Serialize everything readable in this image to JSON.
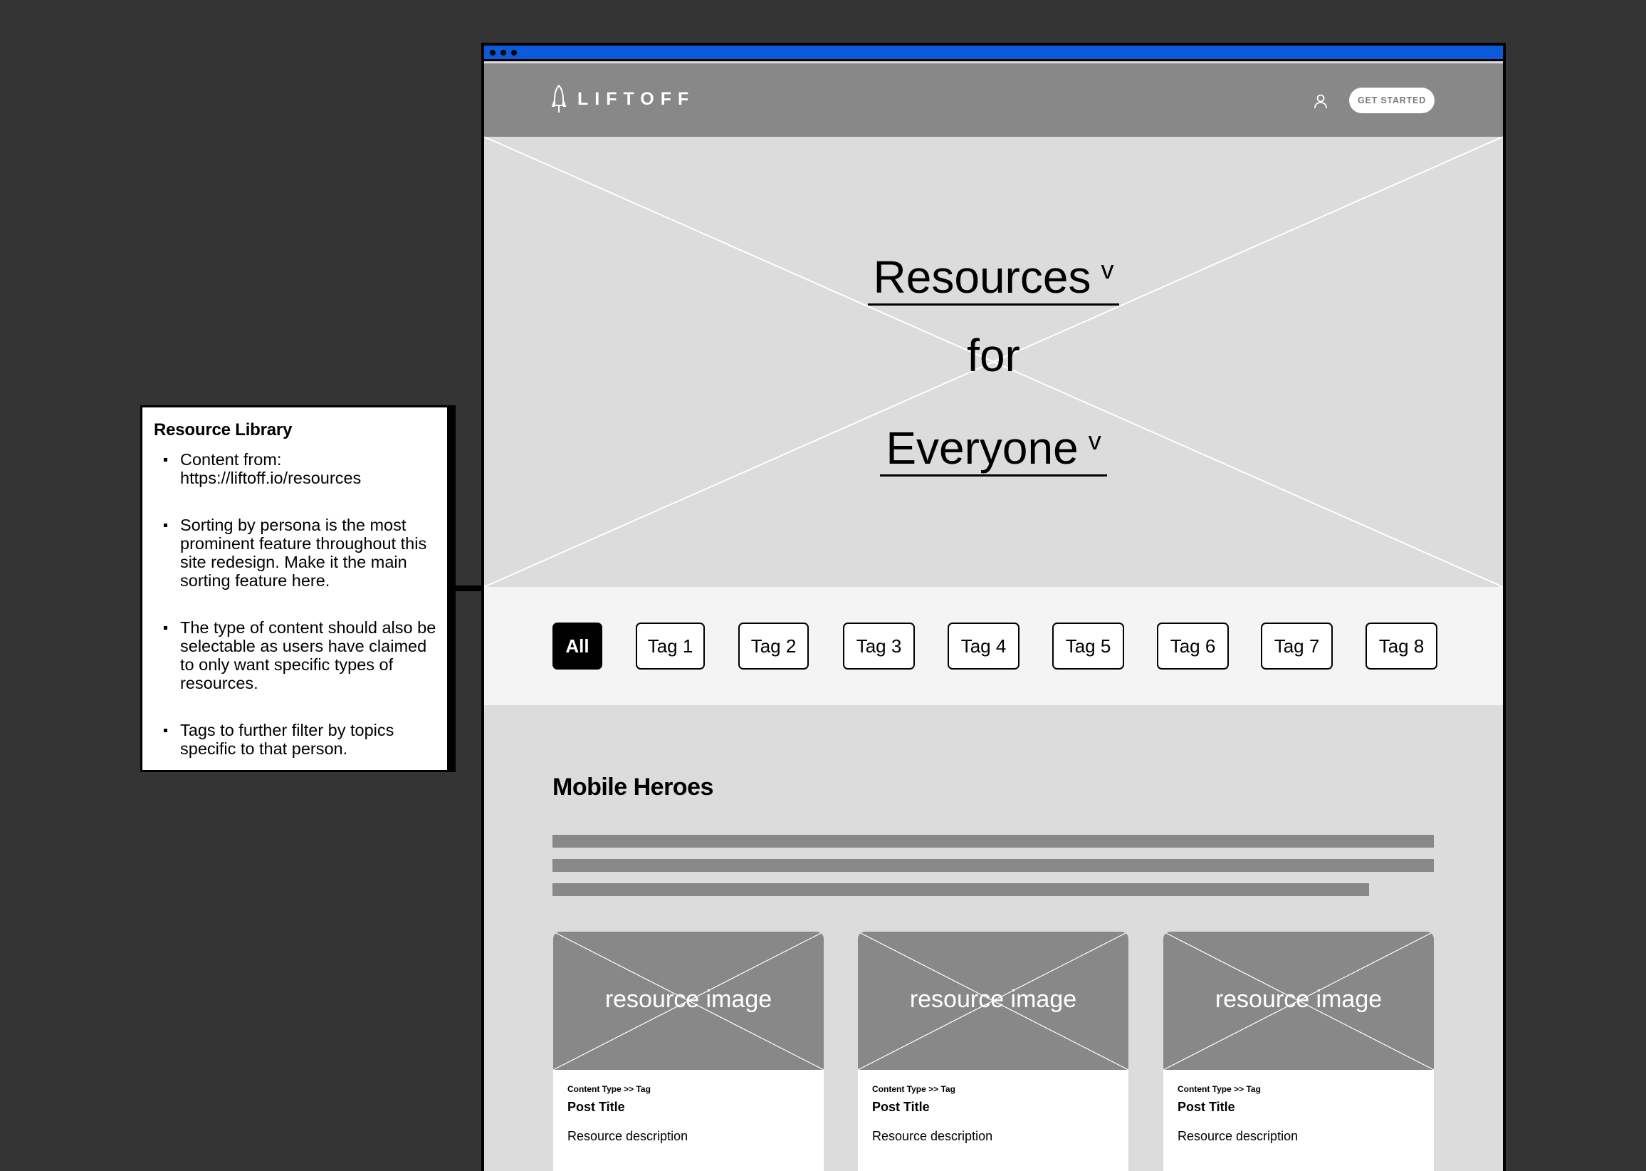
{
  "annotation": {
    "title": "Resource Library",
    "notes": [
      "Content from: https://liftoff.io/resources",
      "Sorting by persona is the most prominent feature throughout this site redesign. Make it the main sorting feature here.",
      "The type of content should also be selectable as users have claimed to only want specific types of resources.",
      "Tags to further filter by topics specific to that person."
    ]
  },
  "header": {
    "logo_text": "LIFTOFF",
    "cta_label": "GET STARTED"
  },
  "hero": {
    "line1": "Resources",
    "line2": "for",
    "line3": "Everyone",
    "caret": "v"
  },
  "tags": [
    "All",
    "Tag 1",
    "Tag 2",
    "Tag 3",
    "Tag 4",
    "Tag 5",
    "Tag 6",
    "Tag 7",
    "Tag 8"
  ],
  "active_tag": "All",
  "section": {
    "title": "Mobile Heroes"
  },
  "cards": [
    {
      "image_label": "resource image",
      "meta": "Content Type  >> Tag",
      "title": "Post Title",
      "description": "Resource description"
    },
    {
      "image_label": "resource image",
      "meta": "Content Type  >> Tag",
      "title": "Post Title",
      "description": "Resource description"
    },
    {
      "image_label": "resource image",
      "meta": "Content Type  >> Tag",
      "title": "Post Title",
      "description": "Resource description"
    }
  ],
  "colors": {
    "background": "#343434",
    "chrome_accent": "#0a5ad9",
    "header_gray": "#888888",
    "placeholder_gray": "#dcdcdc",
    "tag_bar": "#f4f4f4"
  }
}
